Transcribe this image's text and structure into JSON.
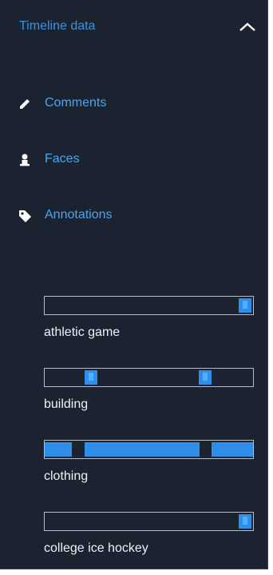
{
  "panel": {
    "title": "Timeline data",
    "collapse_icon": "chevron-up-icon",
    "accent_color": "#3b93dc",
    "background_color": "#1b2230"
  },
  "nav": {
    "items": [
      {
        "label": "Comments",
        "icon": "pencil-icon"
      },
      {
        "label": "Faces",
        "icon": "person-icon"
      },
      {
        "label": "Annotations",
        "icon": "tag-icon"
      }
    ]
  },
  "tags": [
    {
      "label": "athletic game",
      "ranges": [
        [
          0.93,
          0.99
        ]
      ]
    },
    {
      "label": "building",
      "ranges": [
        [
          0.19,
          0.25
        ],
        [
          0.74,
          0.8
        ]
      ]
    },
    {
      "label": "clothing",
      "ranges": [
        [
          0.0,
          0.13
        ],
        [
          0.19,
          0.74
        ],
        [
          0.8,
          1.0
        ]
      ]
    },
    {
      "label": "college ice hockey",
      "ranges": [
        [
          0.93,
          0.99
        ]
      ]
    }
  ]
}
